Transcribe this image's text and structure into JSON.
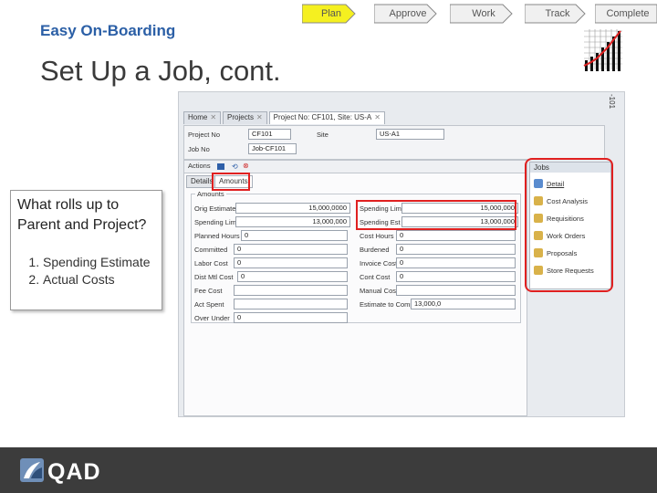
{
  "steps": [
    {
      "label": "Plan",
      "active": true
    },
    {
      "label": "Approve",
      "active": false
    },
    {
      "label": "Work",
      "active": false
    },
    {
      "label": "Track",
      "active": false
    },
    {
      "label": "Complete",
      "active": false
    }
  ],
  "tagline": "Easy On-Boarding",
  "title": "Set Up a Job, cont.",
  "callout": {
    "question": "What rolls up to Parent and Project?",
    "items": [
      "Spending Estimate",
      "Actual Costs"
    ]
  },
  "screenshot": {
    "window_corner": "-101",
    "tabs": [
      {
        "label": "Home"
      },
      {
        "label": "Projects"
      },
      {
        "label": "Project No: CF101, Site: US-A"
      }
    ],
    "header": {
      "project_no_label": "Project No",
      "project_no": "CF101",
      "job_no_label": "Job No",
      "job_no": "Job-CF101",
      "site_label": "Site",
      "site": "US-A1"
    },
    "toolbar": {
      "actions_label": "Actions"
    },
    "subtabs": {
      "details": "Details",
      "amounts": "Amounts"
    },
    "group_label": "Amounts",
    "left_fields": [
      {
        "label": "Orig Estimate",
        "value": "15,000,0000"
      },
      {
        "label": "Spending Limit",
        "value": "13,000,000"
      },
      {
        "label": "Planned Hours",
        "value": "0"
      },
      {
        "label": "Committed",
        "value": "0"
      },
      {
        "label": "Labor Cost",
        "value": "0"
      },
      {
        "label": "Dist Mtl Cost",
        "value": "0"
      },
      {
        "label": "Fee Cost",
        "value": ""
      },
      {
        "label": "Act Spent",
        "value": ""
      },
      {
        "label": "Over Under",
        "value": "0"
      }
    ],
    "right_fields": [
      {
        "label": "Spending Limit",
        "value": "15,000,000"
      },
      {
        "label": "Spending Est",
        "value": "13,000,000"
      },
      {
        "label": "Cost Hours",
        "value": "0"
      },
      {
        "label": "Burdened",
        "value": "0"
      },
      {
        "label": "Invoice Cost",
        "value": "0"
      },
      {
        "label": "Cont Cost",
        "value": "0"
      },
      {
        "label": "Manual Cost",
        "value": ""
      },
      {
        "label": "Estimate to Complete",
        "value": "13,000,0"
      }
    ],
    "jobs_panel": {
      "title": "Jobs",
      "items": [
        {
          "label": "Detail",
          "icon": "detail-icon",
          "color": "#5a8ccf"
        },
        {
          "label": "Cost Analysis",
          "icon": "cost-analysis-icon",
          "color": "#d9b24a"
        },
        {
          "label": "Requisitions",
          "icon": "requisitions-icon",
          "color": "#d9b24a"
        },
        {
          "label": "Work Orders",
          "icon": "work-orders-icon",
          "color": "#d9b24a"
        },
        {
          "label": "Proposals",
          "icon": "proposals-icon",
          "color": "#d9b24a"
        },
        {
          "label": "Store Requests",
          "icon": "store-requests-icon",
          "color": "#d9b24a"
        }
      ]
    }
  },
  "footer": {
    "logo": "QAD"
  },
  "colors": {
    "accent_yellow": "#f5f020",
    "arrow_gray": "#f0f0f0",
    "highlight_red": "#e02020",
    "title_blue": "#2b5fa6",
    "bar_dark": "#3c3c3c"
  }
}
